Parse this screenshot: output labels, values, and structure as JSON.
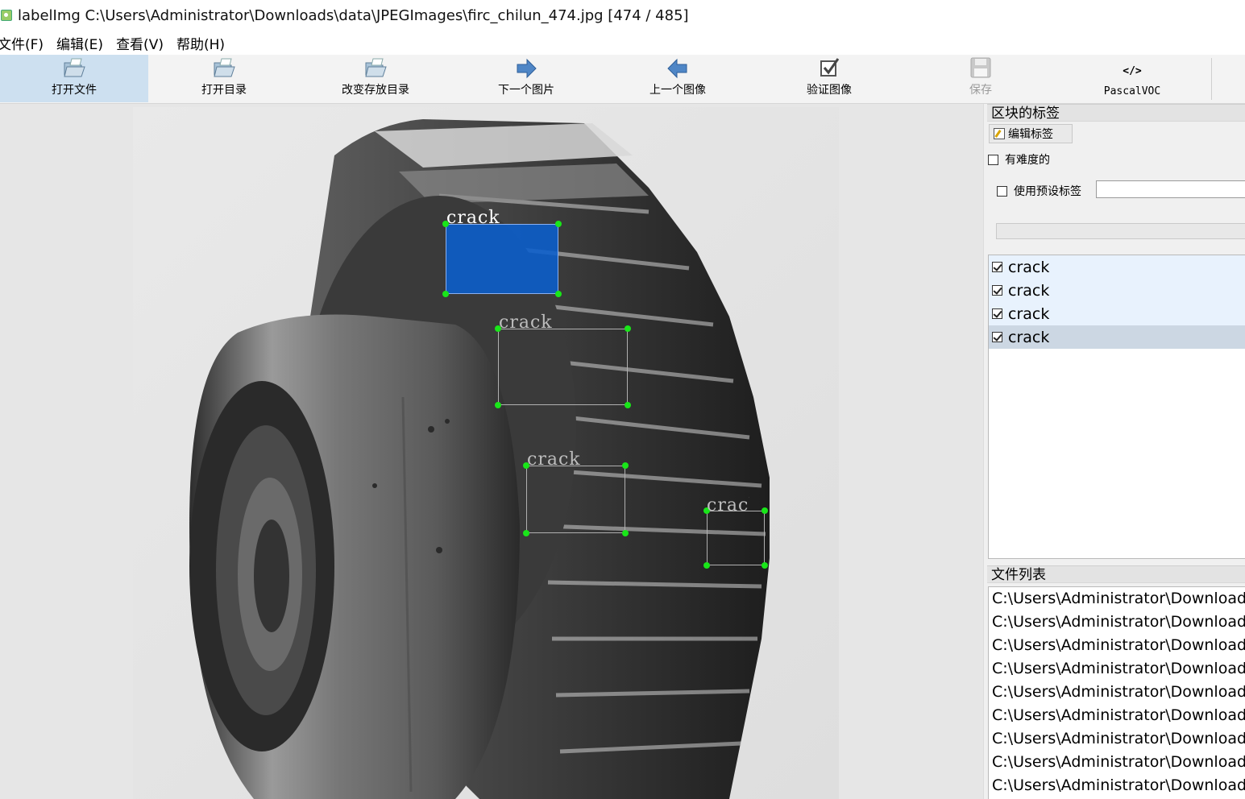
{
  "window": {
    "title": "labelImg C:\\Users\\Administrator\\Downloads\\data\\JPEGImages\\firc_chilun_474.jpg [474 / 485]"
  },
  "menu": [
    "文件(F)",
    "编辑(E)",
    "查看(V)",
    "帮助(H)"
  ],
  "toolbar": {
    "open_file": "打开文件",
    "open_dir": "打开目录",
    "change_save_dir": "改变存放目录",
    "next_image": "下一个图片",
    "prev_image": "上一个图像",
    "verify_image": "验证图像",
    "save": "保存",
    "format": "PascalVOC",
    "format_icon_text": "</>",
    "save_enabled": false
  },
  "canvas": {
    "boxes": [
      {
        "label": "crack",
        "selected": true
      },
      {
        "label": "crack",
        "selected": false
      },
      {
        "label": "crack",
        "selected": false
      },
      {
        "label": "crack",
        "selected": false
      }
    ]
  },
  "box_labels_panel": {
    "title": "区块的标签",
    "edit_label_button": "编辑标签",
    "difficult": {
      "label": "有难度的",
      "checked": false
    },
    "use_default_label": {
      "label": "使用预设标签",
      "checked": false,
      "value": ""
    },
    "labels": [
      {
        "text": "crack",
        "checked": true,
        "selected": false
      },
      {
        "text": "crack",
        "checked": true,
        "selected": false
      },
      {
        "text": "crack",
        "checked": true,
        "selected": false
      },
      {
        "text": "crack",
        "checked": true,
        "selected": true
      }
    ]
  },
  "file_list_panel": {
    "title": "文件列表",
    "files": [
      "C:\\Users\\Administrator\\Downloads",
      "C:\\Users\\Administrator\\Downloads",
      "C:\\Users\\Administrator\\Downloads",
      "C:\\Users\\Administrator\\Downloads",
      "C:\\Users\\Administrator\\Downloads",
      "C:\\Users\\Administrator\\Downloads",
      "C:\\Users\\Administrator\\Downloads",
      "C:\\Users\\Administrator\\Downloads",
      "C:\\Users\\Administrator\\Downloads"
    ]
  },
  "colors": {
    "selected_box_fill": "#0a5fcd",
    "handle": "#19e619",
    "active_tool": "#cde0f0",
    "selected_label_row": "#ccd7e3"
  }
}
